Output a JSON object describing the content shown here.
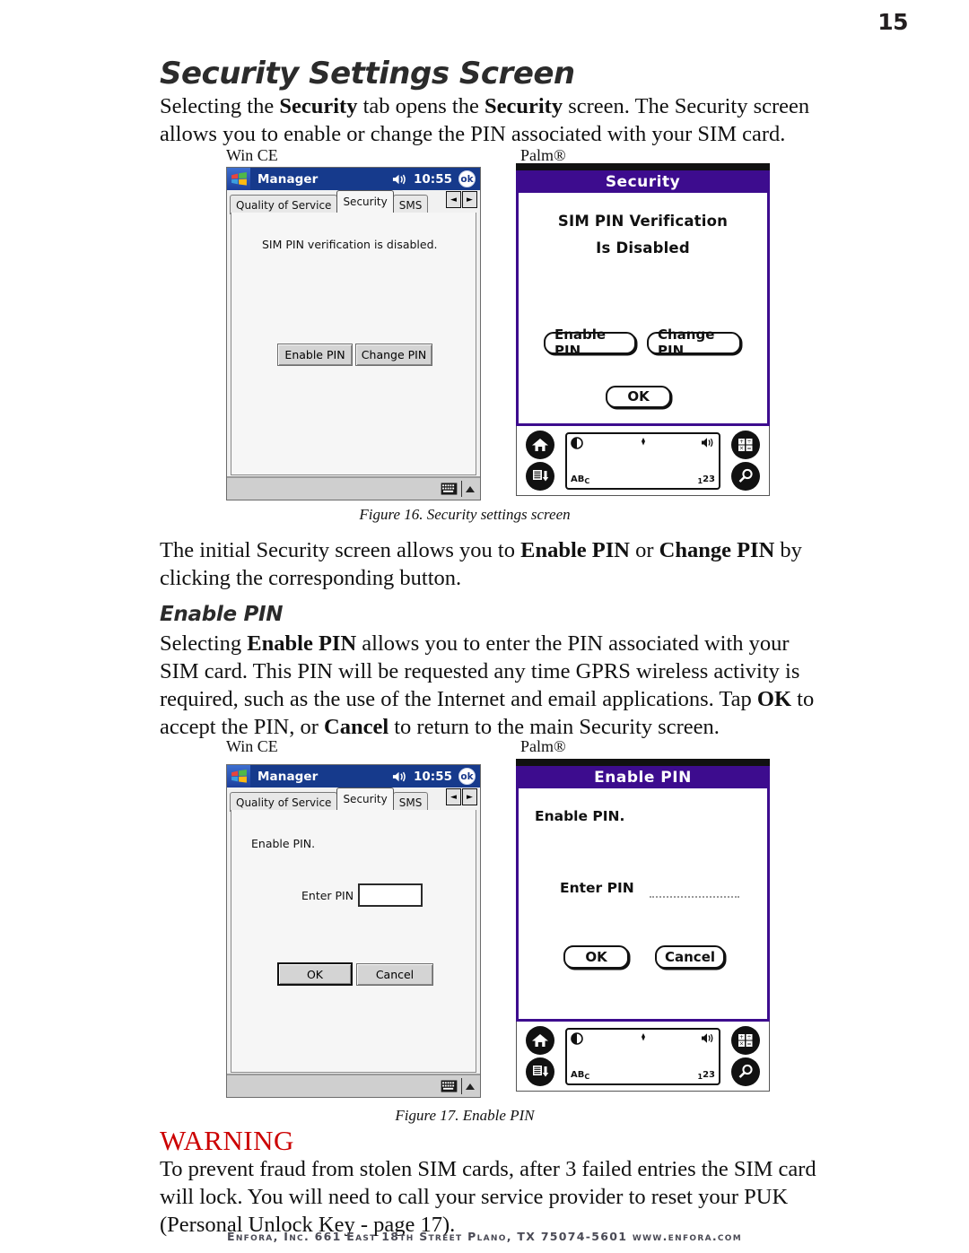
{
  "page": {
    "number": "15",
    "heading": "Security Settings Screen",
    "subheading": "Enable PIN",
    "warning_label": "WARNING",
    "footer": "Enfora, Inc.  661 East 18th Street  Plano, TX  75074-5601  www.enfora.com",
    "accent_red": "#cc0000",
    "palm_purple": "#3d0c8e",
    "wince_blue": "#163a8c"
  },
  "paragraphs": {
    "intro_1": "Selecting the ",
    "intro_b1": "Security",
    "intro_2": " tab opens the ",
    "intro_b2": "Security",
    "intro_3": " screen. The Security screen allows you to enable or change the PIN associated with your SIM card.",
    "after_fig16_1": "The initial Security screen allows you to ",
    "after_fig16_b1": "Enable PIN",
    "after_fig16_2": " or ",
    "after_fig16_b2": "Change PIN",
    "after_fig16_3": " by clicking the corresponding button.",
    "enable_pin_1": "Selecting ",
    "enable_pin_b1": "Enable PIN",
    "enable_pin_2": " allows you to enter the PIN associated with your SIM card.  This PIN will be requested any time GPRS wireless activity is required, such as the use of the Internet and email applications.  Tap ",
    "enable_pin_b2": "OK",
    "enable_pin_3": " to accept the PIN, or ",
    "enable_pin_b3": "Cancel",
    "enable_pin_4": " to return to the main Security screen.",
    "warning_text": "To prevent fraud from stolen SIM cards, after 3 failed entries the SIM card will lock. You will need to call your service provider to reset your PUK (Personal Unlock Key - page 17)."
  },
  "figures": {
    "fig16_caption": "Figure 16.  Security settings screen",
    "fig17_caption": "Figure 17.  Enable PIN",
    "label_wince": "Win CE",
    "label_palm": "Palm®"
  },
  "wince_security": {
    "title": "Manager",
    "clock": "10:55",
    "ok_label": "ok",
    "tabs": [
      {
        "label": "Quality of Service",
        "active": false
      },
      {
        "label": "Security",
        "active": true
      },
      {
        "label": "SMS",
        "active": false
      }
    ],
    "spin_left": "◄",
    "spin_right": "►",
    "status_text": "SIM PIN verification is disabled.",
    "buttons": [
      {
        "label": "Enable PIN"
      },
      {
        "label": "Change PIN"
      }
    ]
  },
  "wince_enable": {
    "title": "Manager",
    "clock": "10:55",
    "ok_label": "ok",
    "tabs": [
      {
        "label": "Quality of Service",
        "active": false
      },
      {
        "label": "Security",
        "active": true
      },
      {
        "label": "SMS",
        "active": false
      }
    ],
    "spin_left": "◄",
    "spin_right": "►",
    "status_text": "Enable PIN.",
    "field_label": "Enter PIN",
    "field_value": "",
    "buttons": [
      {
        "label": "OK",
        "default": true
      },
      {
        "label": "Cancel",
        "default": false
      }
    ]
  },
  "palm_security": {
    "title": "Security",
    "line1": "SIM PIN Verification",
    "line2": "Is Disabled",
    "buttons": [
      {
        "label": "Enable PIN"
      },
      {
        "label": "Change PIN"
      }
    ],
    "ok_label": "OK"
  },
  "palm_enable": {
    "title": "Enable PIN",
    "line1": "Enable PIN.",
    "field_label": "Enter PIN",
    "field_value": "",
    "buttons": [
      {
        "label": "OK"
      },
      {
        "label": "Cancel"
      }
    ]
  },
  "palm_silkscreen": {
    "abc_label": "AB",
    "abc_sub": "C",
    "num_label": "23",
    "num_sub": "1"
  }
}
